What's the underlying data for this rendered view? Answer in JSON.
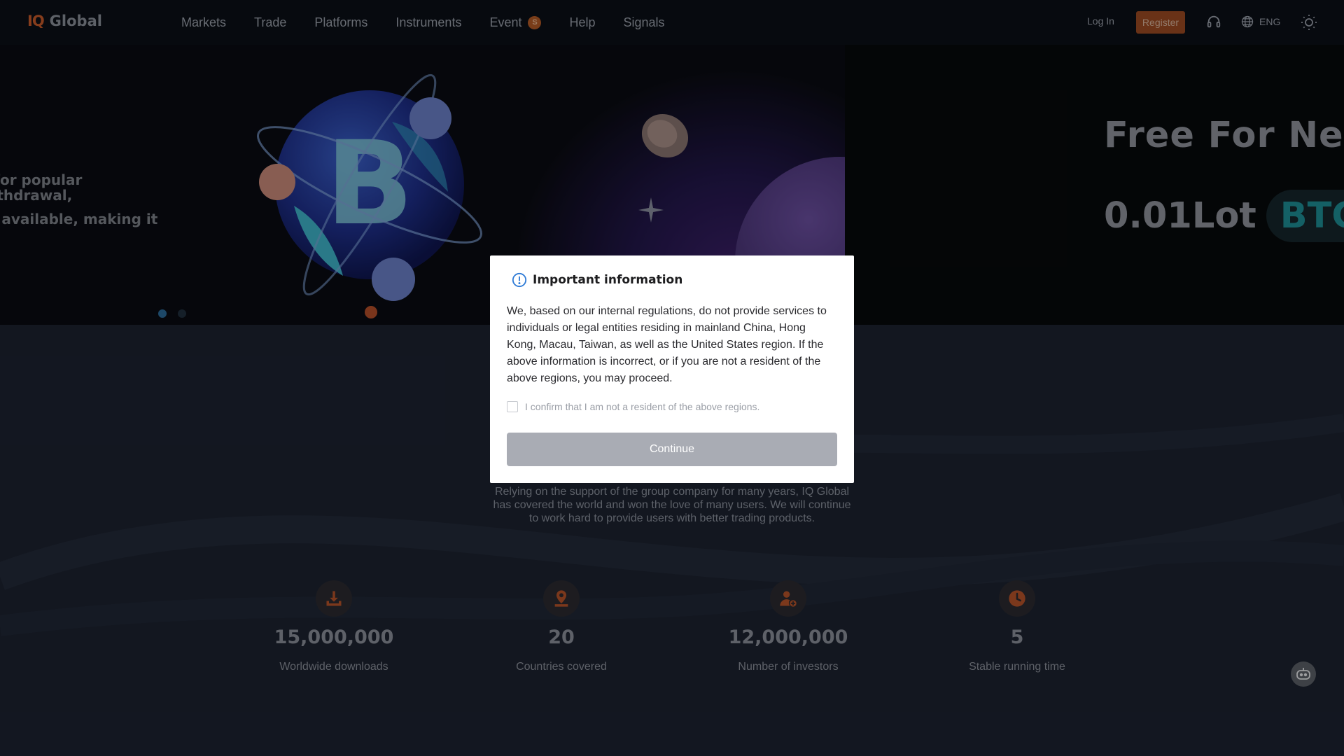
{
  "header": {
    "logo": {
      "mark": "IQ",
      "name": "Global"
    },
    "nav": [
      "Markets",
      "Trade",
      "Platforms",
      "Instruments",
      "Event",
      "Help",
      "Signals"
    ],
    "event_badge": "S",
    "login_label": "Log In",
    "register_label": "Register",
    "language": "ENG",
    "icons": [
      "headset-icon",
      "globe-icon",
      "sun-icon"
    ]
  },
  "hero": {
    "slide_text": [
      "g for popular",
      "withdrawal,",
      "ce available, making it",
      "t"
    ],
    "promo_line1": "Free For Nev",
    "promo_lot": "0.01Lot",
    "promo_btc": "BTC",
    "active_slide": 1,
    "slide_count": 2
  },
  "about": {
    "text": "Relying on the support of the group company for many years, IQ Global has covered the world and won the love of many users. We will continue to work hard to provide users with better trading products."
  },
  "stats": [
    {
      "icon": "download-icon",
      "value": "15,000,000",
      "label": "Worldwide downloads"
    },
    {
      "icon": "location-pin-icon",
      "value": "20",
      "label": "Countries covered"
    },
    {
      "icon": "add-user-icon",
      "value": "12,000,000",
      "label": "Number of investors"
    },
    {
      "icon": "clock-icon",
      "value": "5",
      "label": "Stable running time"
    }
  ],
  "modal": {
    "title": "Important information",
    "body": "We, based on our internal regulations, do not provide services to individuals or legal entities residing in mainland China, Hong Kong, Macau, Taiwan, as well as the United States region. If the above information is incorrect, or if you are not a resident of the above regions, you may proceed.",
    "confirm_label": "I confirm that I am not a resident of the above regions.",
    "confirm_checked": false,
    "continue_label": "Continue"
  },
  "colors": {
    "accent": "#c65a2a",
    "register_bg": "#9b4a22",
    "page_bg": "#1c2230",
    "header_bg": "#0b0f17",
    "continue_disabled": "#a9acb4",
    "info_blue": "#2f7bd6"
  }
}
